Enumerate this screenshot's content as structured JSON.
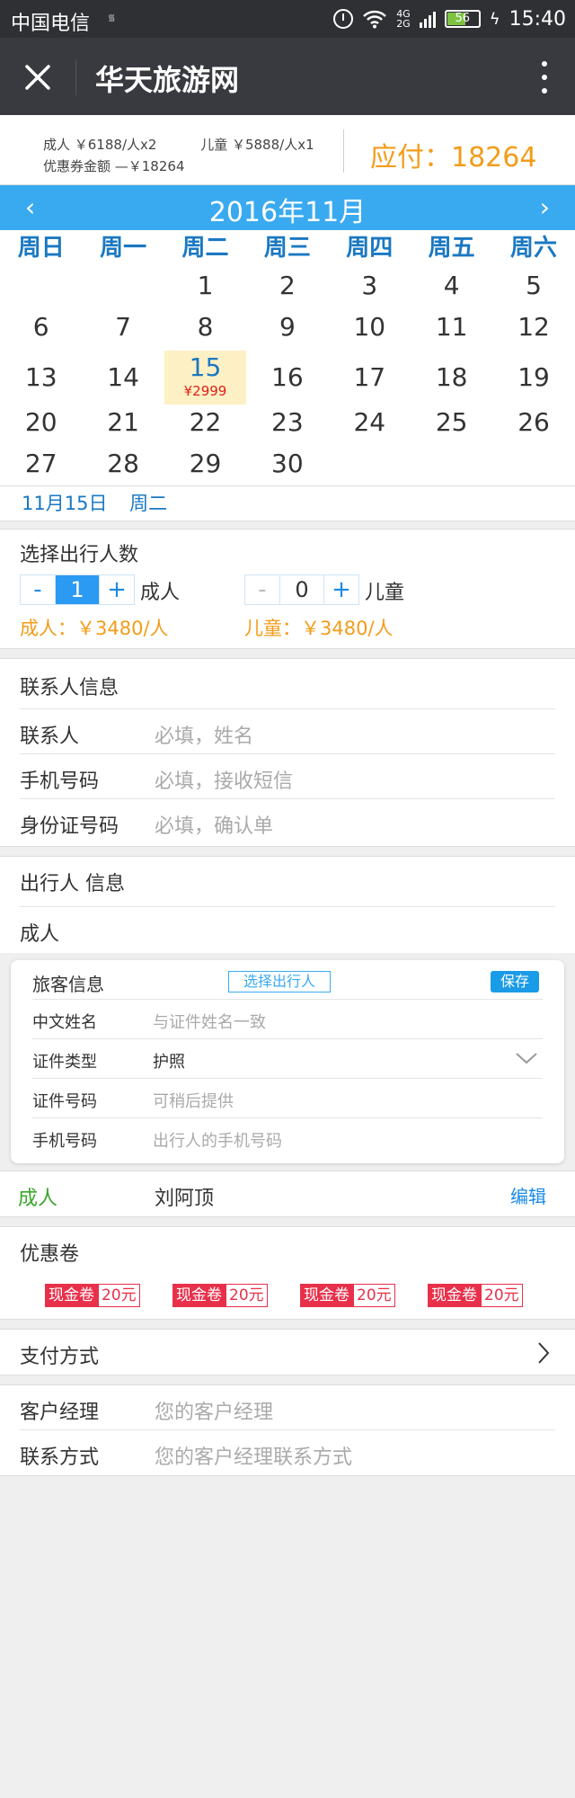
{
  "status_bar": {
    "carrier": "中国电信",
    "network_top": "4G",
    "network_bottom": "2G",
    "battery": "56",
    "time": "15:40"
  },
  "titlebar": {
    "title": "华天旅游网"
  },
  "summary": {
    "adult": "成人 ￥6188/人x2",
    "child": "儿童 ￥5888/人x1",
    "coupon": "优惠券金额 —￥18264",
    "due": "应付：18264"
  },
  "calendar": {
    "month": "2016年11月",
    "prev": "‹",
    "next": "›",
    "weekdays": [
      "周日",
      "周一",
      "周二",
      "周三",
      "周四",
      "周五",
      "周六"
    ],
    "weeks": [
      [
        "",
        "",
        "1",
        "2",
        "3",
        "4",
        "5"
      ],
      [
        "6",
        "7",
        "8",
        "9",
        "10",
        "11",
        "12"
      ],
      [
        "13",
        "14",
        "15",
        "16",
        "17",
        "18",
        "19"
      ],
      [
        "20",
        "21",
        "22",
        "23",
        "24",
        "25",
        "26"
      ],
      [
        "27",
        "28",
        "29",
        "30",
        "",
        "",
        ""
      ]
    ],
    "selected_day": "15",
    "selected_price": "¥2999",
    "selected_date": "11月15日",
    "selected_weekday": "周二"
  },
  "travellers": {
    "heading": "选择出行人数",
    "minus": "-",
    "plus": "+",
    "adult_count": "1",
    "adult_label": "成人",
    "child_count": "0",
    "child_label": "儿童",
    "adult_rate": "成人：￥3480/人",
    "child_rate": "儿童：￥3480/人"
  },
  "contact": {
    "heading": "联系人信息",
    "rows": [
      {
        "label": "联系人",
        "placeholder": "必填，姓名"
      },
      {
        "label": "手机号码",
        "placeholder": "必填，接收短信"
      },
      {
        "label": "身份证号码",
        "placeholder": "必填，确认单"
      }
    ]
  },
  "traveller_info": {
    "heading": "出行人 信息",
    "sub": "成人",
    "box_title": "旅客信息",
    "pick_button": "选择出行人",
    "save_button": "保存",
    "rows": [
      {
        "label": "中文姓名",
        "placeholder": "与证件姓名一致"
      },
      {
        "label": "证件类型",
        "value": "护照"
      },
      {
        "label": "证件号码",
        "placeholder": "可稍后提供"
      },
      {
        "label": "手机号码",
        "placeholder": "出行人的手机号码"
      }
    ],
    "saved_type": "成人",
    "saved_name": "刘阿顶",
    "edit": "编辑"
  },
  "coupons": {
    "heading": "优惠卷",
    "items": [
      {
        "label": "现金卷",
        "amount": "20元"
      },
      {
        "label": "现金卷",
        "amount": "20元"
      },
      {
        "label": "现金卷",
        "amount": "20元"
      },
      {
        "label": "现金卷",
        "amount": "20元"
      }
    ]
  },
  "payment": {
    "label": "支付方式"
  },
  "manager": {
    "rows": [
      {
        "label": "客户经理",
        "placeholder": "您的客户经理"
      },
      {
        "label": "联系方式",
        "placeholder": "您的客户经理联系方式"
      }
    ]
  },
  "colors": {
    "accent_blue": "#3aaaf0",
    "orange": "#f39c1a",
    "green": "#3aa72c",
    "red": "#e8304a"
  }
}
